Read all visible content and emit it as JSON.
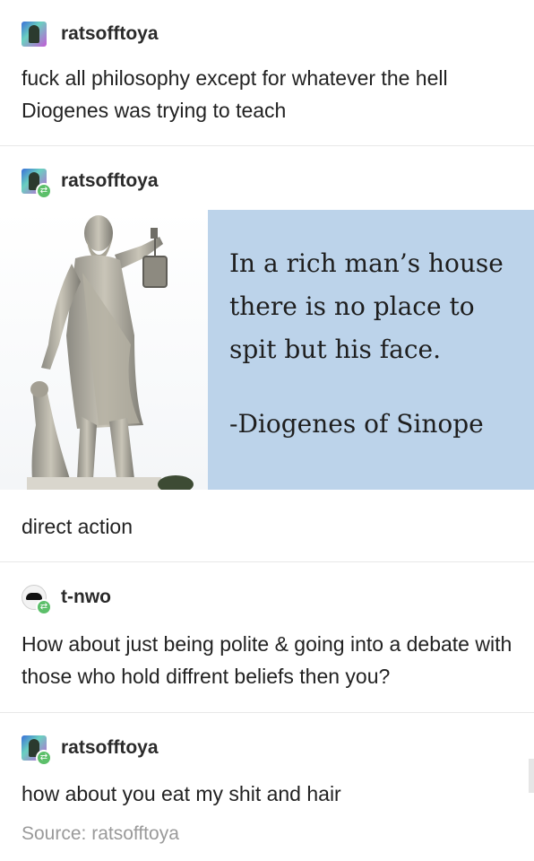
{
  "posts": [
    {
      "username": "ratsofftoya",
      "reblog": false,
      "text": "fuck all philosophy except for whatever the hell Diogenes was trying to teach"
    },
    {
      "username": "ratsofftoya",
      "reblog": true,
      "image": {
        "quote": "In a rich man’s house\nthere is no place to\nspit but his face.",
        "author": "-Diogenes of Sinope"
      },
      "text": "direct action"
    },
    {
      "username": "t-nwo",
      "reblog": true,
      "text": "How about just being polite & going into a debate with those who hold diffrent beliefs then you?"
    },
    {
      "username": "ratsofftoya",
      "reblog": true,
      "text": "how about you eat my shit and hair"
    }
  ],
  "source": "Source: ratsofftoya",
  "colors": {
    "quote_panel": "#bcd3ea",
    "reblog_badge": "#5cbf6a",
    "source_text": "#9a9a9a"
  },
  "icons": [
    "avatar-ratsofftoya",
    "avatar-tnwo",
    "reblog-icon"
  ]
}
